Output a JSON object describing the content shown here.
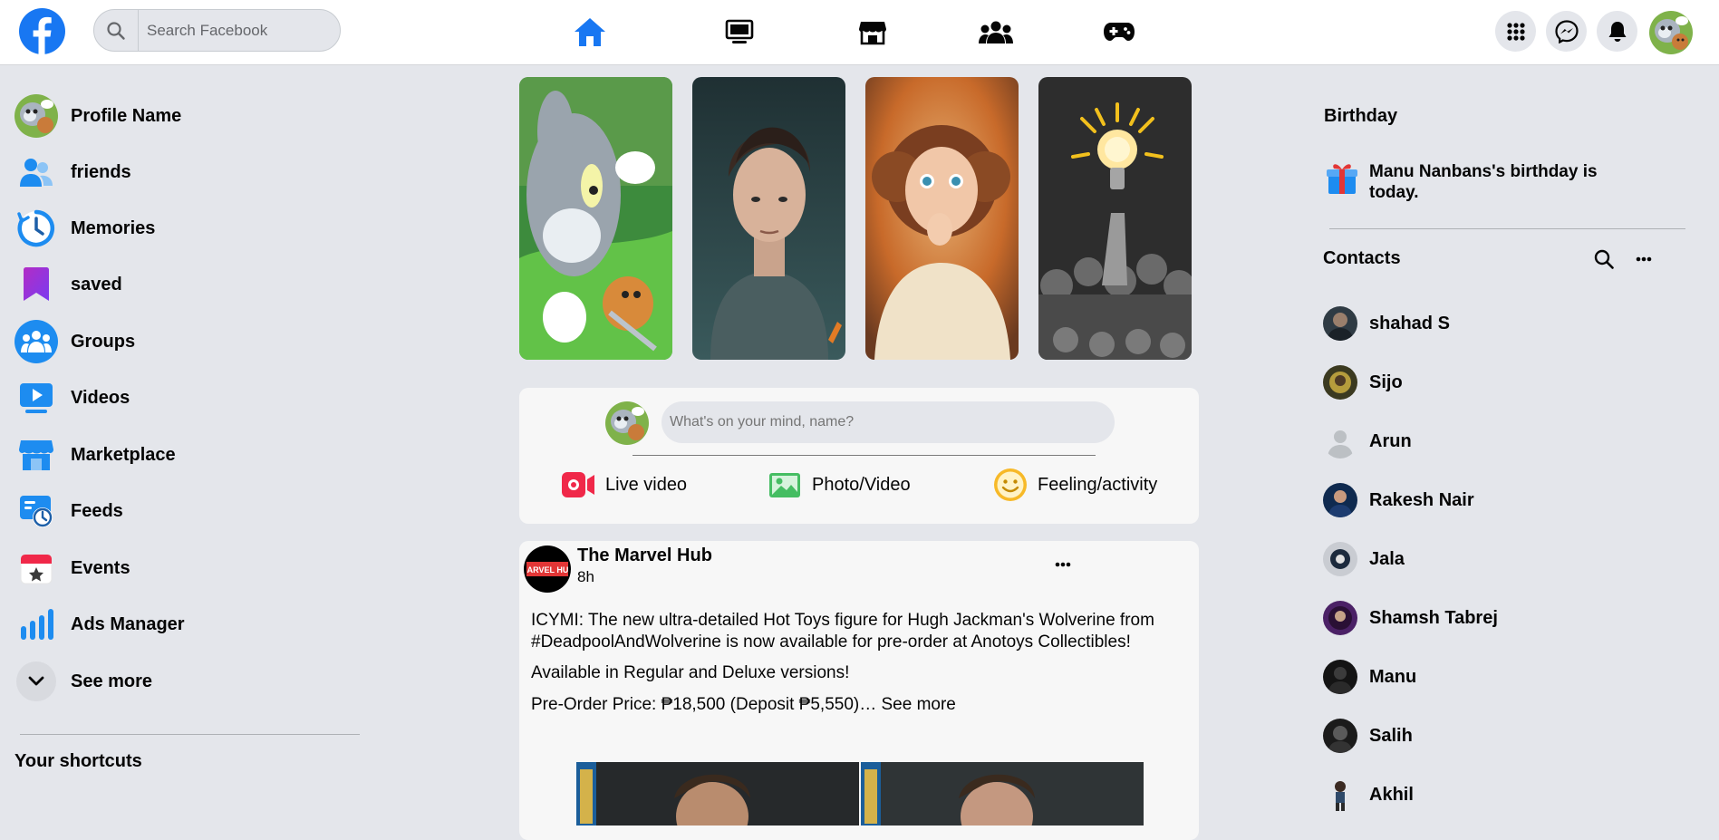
{
  "header": {
    "search_placeholder": "Search Facebook",
    "logo_icon": "facebook-logo",
    "nav": [
      {
        "name": "home-icon",
        "active": true
      },
      {
        "name": "watch-icon",
        "active": false
      },
      {
        "name": "marketplace-icon",
        "active": false
      },
      {
        "name": "groups-icon",
        "active": false
      },
      {
        "name": "gaming-icon",
        "active": false
      }
    ],
    "right_icons": [
      "menu-grid-icon",
      "messenger-icon",
      "notifications-icon",
      "profile-avatar"
    ],
    "accent_color": "#1877f2"
  },
  "sidebar": {
    "items": [
      {
        "label": "Profile Name",
        "icon": "profile-avatar"
      },
      {
        "label": "friends",
        "icon": "friends-icon"
      },
      {
        "label": "Memories",
        "icon": "memories-icon"
      },
      {
        "label": "saved",
        "icon": "saved-icon"
      },
      {
        "label": "Groups",
        "icon": "groups-icon"
      },
      {
        "label": "Videos",
        "icon": "videos-icon"
      },
      {
        "label": "Marketplace",
        "icon": "marketplace-icon"
      },
      {
        "label": "Feeds",
        "icon": "feeds-icon"
      },
      {
        "label": "Events",
        "icon": "events-icon"
      },
      {
        "label": "Ads Manager",
        "icon": "ads-manager-icon"
      },
      {
        "label": "See more",
        "icon": "chevron-down-icon"
      }
    ],
    "shortcuts_heading": "Your shortcuts"
  },
  "stories": [
    {
      "name": "story-cartoon"
    },
    {
      "name": "story-boy"
    },
    {
      "name": "story-girl"
    },
    {
      "name": "story-lightbulb"
    }
  ],
  "composer": {
    "placeholder": "What's on your mind, name?",
    "actions": [
      {
        "label": "Live video",
        "icon": "live-video-icon"
      },
      {
        "label": "Photo/Video",
        "icon": "photo-video-icon"
      },
      {
        "label": "Feeling/activity",
        "icon": "feeling-icon"
      }
    ]
  },
  "post": {
    "author": "The Marvel Hub",
    "avatar_text": "MARVEL HUB",
    "time": "8h",
    "paragraphs": [
      "ICYMI: The new ultra-detailed Hot Toys figure for Hugh Jackman's Wolverine from #DeadpoolAndWolverine is now available for pre-order at Anotoys Collectibles!",
      "Available in Regular and Deluxe versions!",
      "Pre-Order Price: ₱18,500 (Deposit ₱5,550)… See more"
    ]
  },
  "right": {
    "birthday_heading": "Birthday",
    "birthday_text": "Manu Nanbans's birthday is today.",
    "contacts_heading": "Contacts",
    "contacts": [
      {
        "name": "shahad S"
      },
      {
        "name": "Sijo"
      },
      {
        "name": "Arun"
      },
      {
        "name": "Rakesh Nair"
      },
      {
        "name": "Jala"
      },
      {
        "name": "Shamsh Tabrej"
      },
      {
        "name": "Manu"
      },
      {
        "name": "Salih"
      },
      {
        "name": "Akhil"
      }
    ]
  }
}
